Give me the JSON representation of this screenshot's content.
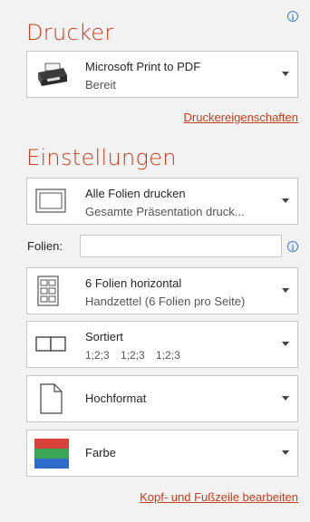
{
  "printer": {
    "title": "Drucker",
    "name": "Microsoft Print to PDF",
    "status": "Bereit",
    "properties_link": "Druckereigenschaften"
  },
  "settings": {
    "title": "Einstellungen",
    "slides_range": {
      "label": "Alle Folien drucken",
      "sub": "Gesamte Präsentation druck..."
    },
    "slides_field": {
      "label": "Folien:",
      "value": "",
      "placeholder": ""
    },
    "layout": {
      "label": "6 Folien horizontal",
      "sub": "Handzettel (6 Folien pro Seite)"
    },
    "collation": {
      "label": "Sortiert",
      "sub": "1;2;3   1;2;3   1;2;3"
    },
    "orientation": {
      "label": "Hochformat"
    },
    "color": {
      "label": "Farbe",
      "colors": [
        "#d9423a",
        "#3aa757",
        "#2f6bc9"
      ]
    },
    "header_footer_link": "Kopf- und Fußzeile bearbeiten"
  },
  "icons": {
    "info": "info-icon",
    "printer": "printer-icon",
    "slides": "slides-icon",
    "grid": "handout-grid-icon",
    "collate": "collate-icon",
    "page": "portrait-page-icon",
    "color": "color-swatch-icon",
    "dropdown": "chevron-down-icon"
  }
}
